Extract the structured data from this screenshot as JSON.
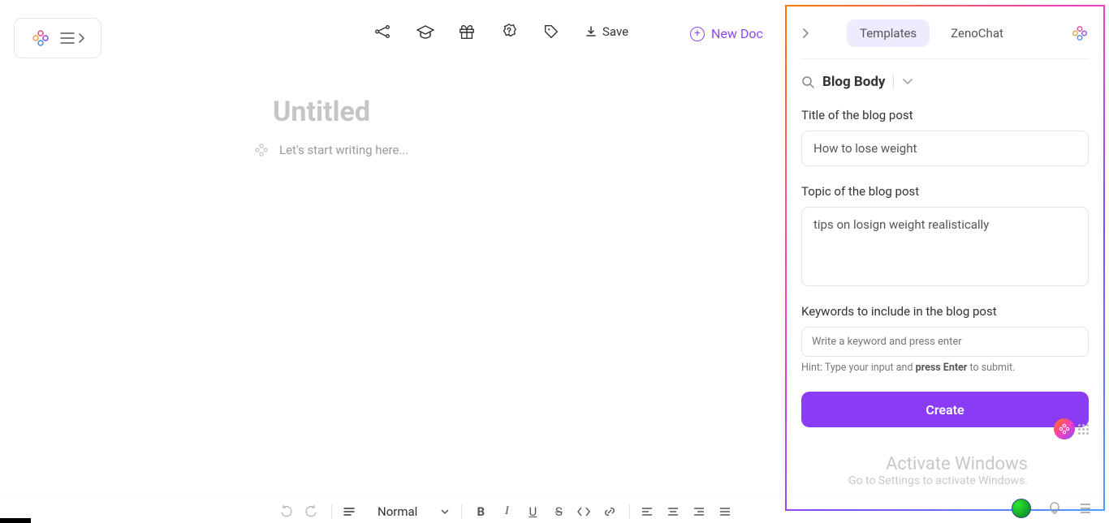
{
  "header": {
    "new_doc_label": "New Doc",
    "save_label": "Save"
  },
  "document": {
    "title_placeholder": "Untitled",
    "body_placeholder": "Let's start writing here..."
  },
  "sidepanel": {
    "tabs": {
      "templates": "Templates",
      "zenochat": "ZenoChat"
    },
    "template_name": "Blog Body",
    "fields": {
      "title_label": "Title of the blog post",
      "title_value": "How to lose weight",
      "topic_label": "Topic of the blog post",
      "topic_value": "tips on losign weight realistically",
      "keywords_label": "Keywords to include in the blog post",
      "keywords_placeholder": "Write a keyword and press enter",
      "hint_prefix": "Hint: Type your input and ",
      "hint_bold": "press Enter",
      "hint_suffix": " to submit."
    },
    "create_label": "Create"
  },
  "toolbar": {
    "style_label": "Normal"
  },
  "watermark": {
    "line1": "Activate Windows",
    "line2": "Go to Settings to activate Windows."
  }
}
